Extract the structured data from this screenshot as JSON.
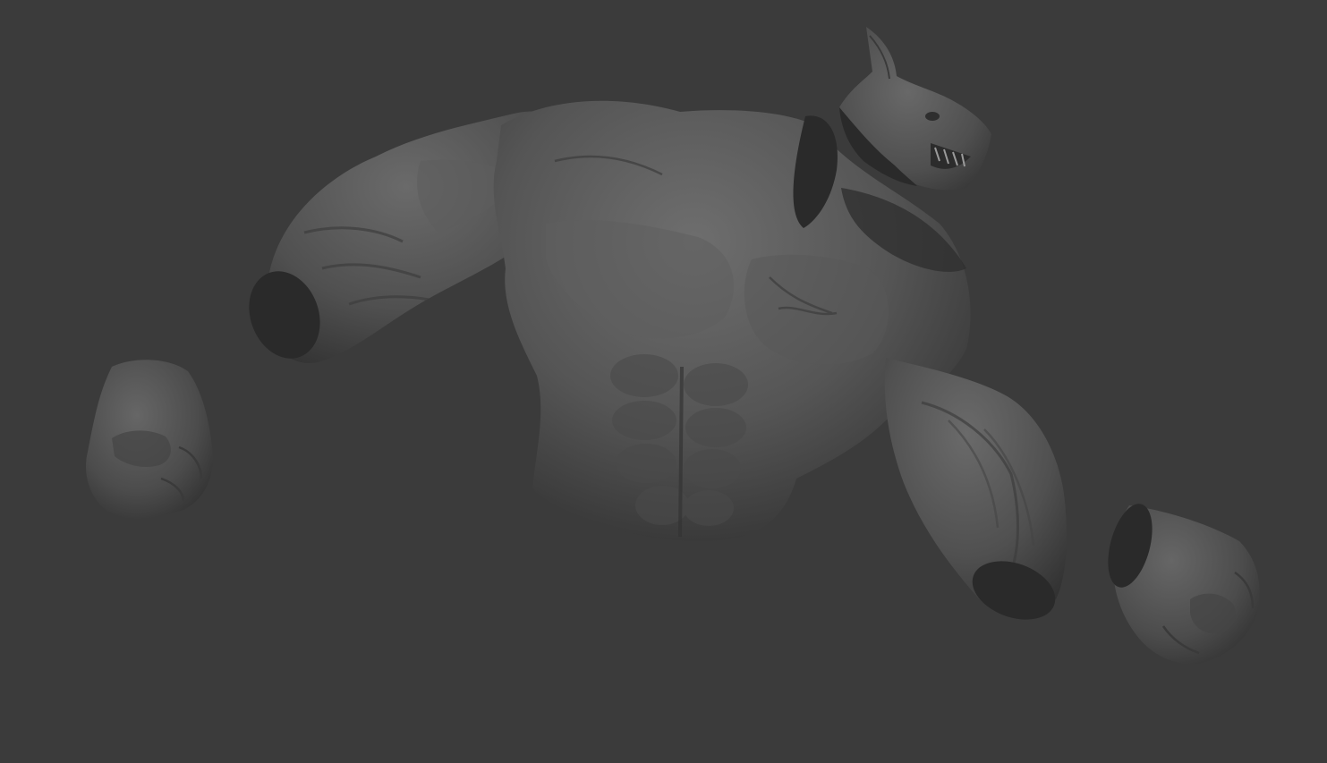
{
  "viewport": {
    "background_color": "#3b3b3b",
    "mesh_color": "#5a5a5a",
    "mesh_shadow_color": "#2c2c2c",
    "mesh_highlight_color": "#6c6c6c",
    "cut_face_color": "#2a2a2a"
  },
  "meshes": [
    {
      "name": "torso",
      "icon": "sculpt-torso"
    },
    {
      "name": "right-upper-arm",
      "icon": "sculpt-arm"
    },
    {
      "name": "left-upper-arm",
      "icon": "sculpt-arm"
    },
    {
      "name": "werewolf-head",
      "icon": "sculpt-head"
    },
    {
      "name": "right-fist",
      "icon": "sculpt-fist"
    },
    {
      "name": "left-fist",
      "icon": "sculpt-fist"
    }
  ]
}
